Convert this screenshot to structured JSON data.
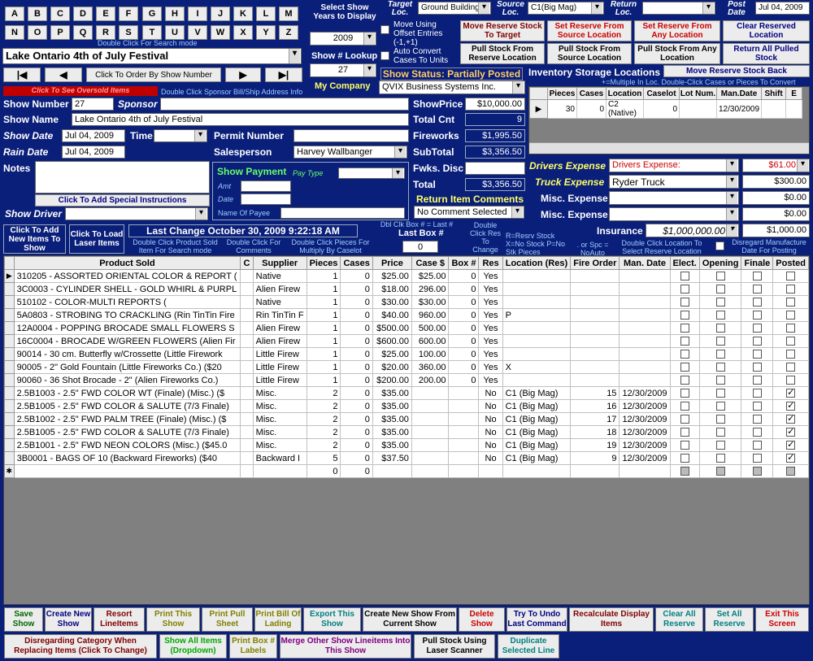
{
  "letters": [
    "A",
    "B",
    "C",
    "D",
    "E",
    "F",
    "G",
    "H",
    "I",
    "J",
    "K",
    "L",
    "M",
    "N",
    "O",
    "P",
    "Q",
    "R",
    "S",
    "T",
    "U",
    "V",
    "W",
    "X",
    "Y",
    "Z"
  ],
  "search_mode_hint": "Double Click For Search mode",
  "show_selector": {
    "value": "Lake Ontario 4th of July Festival"
  },
  "nav": {
    "first": "⏮",
    "prev": "◀",
    "next": "▶",
    "last": "⏭",
    "order_button": "Click To Order By Show Number"
  },
  "years": {
    "label": "Select Show Years to Display",
    "value": "2009"
  },
  "lookup": {
    "label": "Show # Lookup",
    "value": "27"
  },
  "my_company": {
    "label": "My Company",
    "value": "QVIX Business Systems Inc."
  },
  "target_loc": {
    "label": "Target Loc.",
    "value": "Ground Building"
  },
  "source_loc": {
    "label": "Source Loc.",
    "value": "C1(Big Mag)"
  },
  "return_loc": {
    "label": "Return Loc.",
    "value": ""
  },
  "post_date": {
    "label": "Post Date",
    "value": "Jul 04, 2009"
  },
  "offset_check": {
    "label": "Move Using Offset Entries (-1,+1)"
  },
  "auto_convert": {
    "label": "Auto Convert Cases To Units"
  },
  "action_buttons": {
    "move_reserve": "Move Reserve Stock To Target",
    "set_reserve_source": "Set Reserve From Source Location",
    "set_reserve_any": "Set Reserve From Any Location",
    "clear_reserved": "Clear Reserved Location",
    "pull_reserve": "Pull Stock From Reserve Location",
    "pull_source": "Pull Stock From Source Location",
    "pull_any": "Pull Stock From Any Location",
    "return_pulled": "Return All Pulled Stock"
  },
  "show_status": "Show Status: Partially Posted",
  "oversold": "Click To See Oversold Items",
  "sponsor_hint": "Double Click Sponsor Bill/Ship Address Info",
  "inventory": {
    "title": "Inventory Storage Locations",
    "move_back": "Move Reserve Stock Back",
    "hint": "+=Multiple In Loc.  Double-Click Cases or Pieces To Convert",
    "headers": [
      "Pieces",
      "Cases",
      "Location",
      "Caselot",
      "Lot Num.",
      "Man.Date",
      "Shift",
      "E"
    ],
    "row": [
      "30",
      "0",
      "C2 (Native)",
      "0",
      "",
      "12/30/2009",
      "",
      ""
    ]
  },
  "form": {
    "show_number_label": "Show Number",
    "show_number": "27",
    "sponsor_label": "Sponsor",
    "sponsor": "",
    "show_name_label": "Show Name",
    "show_name": "Lake Ontario 4th of July Festival",
    "show_date_label": "Show Date",
    "show_date": "Jul 04, 2009",
    "time_label": "Time",
    "time": "",
    "permit_label": "Permit Number",
    "permit": "",
    "rain_date_label": "Rain Date",
    "rain_date": "Jul 04, 2009",
    "salesperson_label": "Salesperson",
    "salesperson": "Harvey Wallbanger",
    "notes_label": "Notes",
    "notes": "",
    "special_btn": "Click To Add Special Instructions",
    "show_driver_label": "Show Driver",
    "show_driver": ""
  },
  "payment": {
    "title": "Show Payment",
    "pay_type": "Pay Type",
    "amt": "Amt",
    "date": "Date",
    "payee": "Name Of Payee"
  },
  "totals": {
    "show_price_label": "ShowPrice",
    "show_price": "$10,000.00",
    "total_cnt_label": "Total Cnt",
    "total_cnt": "9",
    "fireworks_label": "Fireworks",
    "fireworks": "$1,995.50",
    "subtotal_label": "SubTotal",
    "subtotal": "$3,356.50",
    "disc_label": "Fwks. Disc",
    "disc": "",
    "total_label": "Total",
    "total": "$3,356.50",
    "return_label": "Return Item Comments",
    "return_value": "No Comment Selected"
  },
  "expenses": {
    "drivers_label": "Drivers Expense",
    "drivers_value": "Drivers Expense:",
    "drivers_amt": "$61.00",
    "truck_label": "Truck Expense",
    "truck_value": "Ryder Truck",
    "truck_amt": "$300.00",
    "misc1_label": "Misc. Expense",
    "misc1_amt": "$0.00",
    "misc2_label": "Misc. Expense",
    "misc2_amt": "$0.00",
    "insurance_label": "Insurance",
    "insurance_value": "$1,000,000.00",
    "insurance_amt": "$1,000.00"
  },
  "row_bar": {
    "add_items": "Click To Add New Items To Show",
    "load_laser": "Click To Load Laser Items",
    "last_change": "Last Change October 30, 2009 9:22:18 AM",
    "h1": "Double Click Product Sold Item For Search mode",
    "h2": "Double Click For Comments",
    "h3": "Double Click Pieces For Multiply By Caselot",
    "box_hint": "Dbl Clk Box # = Last #",
    "last_box_label": "Last Box #",
    "last_box": "0",
    "res_hint": "Double Click Res To Change",
    "legend": "R=Resrv Stock X=No Stock P=No Stk Pieces",
    "legend2": ". or Spc = NoAuto",
    "loc_hint": "Double Click Location To Select Reserve Location",
    "disregard": "Disregard Manufacture Date For Posting"
  },
  "grid": {
    "headers": [
      "Product Sold",
      "C",
      "Supplier",
      "Pieces",
      "Cases",
      "Price",
      "Case $",
      "Box #",
      "Res",
      "Location (Res)",
      "Fire Order",
      "Man. Date",
      "Elect.",
      "Opening",
      "Finale",
      "Posted"
    ],
    "rows": [
      {
        "p": "310205 - ASSORTED ORIENTAL COLOR & REPORT (",
        "s": "Native",
        "pc": "1",
        "cs": "0",
        "pr": "$25.00",
        "cd": "$25.00",
        "bx": "0",
        "r": "Yes",
        "l": "",
        "f": "",
        "m": "",
        "e": false,
        "o": false,
        "fi": false,
        "po": false
      },
      {
        "p": "3C0003 - CYLINDER SHELL - GOLD WHIRL & PURPL",
        "s": "Alien Firew",
        "pc": "1",
        "cs": "0",
        "pr": "$18.00",
        "cd": "296.00",
        "bx": "0",
        "r": "Yes",
        "l": "",
        "f": "",
        "m": "",
        "e": false,
        "o": false,
        "fi": false,
        "po": false
      },
      {
        "p": "510102 - COLOR-MULTI REPORTS (",
        "s": "Native",
        "pc": "1",
        "cs": "0",
        "pr": "$30.00",
        "cd": "$30.00",
        "bx": "0",
        "r": "Yes",
        "l": "",
        "f": "",
        "m": "",
        "e": false,
        "o": false,
        "fi": false,
        "po": false
      },
      {
        "p": "5A0803 - STROBING TO CRACKLING (Rin TinTin Fire",
        "s": "Rin TinTin F",
        "pc": "1",
        "cs": "0",
        "pr": "$40.00",
        "cd": "960.00",
        "bx": "0",
        "r": "Yes",
        "l": "P",
        "f": "",
        "m": "",
        "e": false,
        "o": false,
        "fi": false,
        "po": false
      },
      {
        "p": "12A0004 - POPPING BROCADE SMALL FLOWERS S",
        "s": "Alien Firew",
        "pc": "1",
        "cs": "0",
        "pr": "$500.00",
        "cd": "500.00",
        "bx": "0",
        "r": "Yes",
        "l": "",
        "f": "",
        "m": "",
        "e": false,
        "o": false,
        "fi": false,
        "po": false
      },
      {
        "p": "16C0004 - BROCADE W/GREEN FLOWERS (Alien Fir",
        "s": "Alien Firew",
        "pc": "1",
        "cs": "0",
        "pr": "$600.00",
        "cd": "600.00",
        "bx": "0",
        "r": "Yes",
        "l": "",
        "f": "",
        "m": "",
        "e": false,
        "o": false,
        "fi": false,
        "po": false
      },
      {
        "p": "90014 - 30 cm. Butterfly w/Crossette (Little Firework",
        "s": "Little Firew",
        "pc": "1",
        "cs": "0",
        "pr": "$25.00",
        "cd": "100.00",
        "bx": "0",
        "r": "Yes",
        "l": "",
        "f": "",
        "m": "",
        "e": false,
        "o": false,
        "fi": false,
        "po": false
      },
      {
        "p": "90005 - 2\" Gold Fountain (Little Fireworks Co.) ($20",
        "s": "Little Firew",
        "pc": "1",
        "cs": "0",
        "pr": "$20.00",
        "cd": "360.00",
        "bx": "0",
        "r": "Yes",
        "l": "X",
        "f": "",
        "m": "",
        "e": false,
        "o": false,
        "fi": false,
        "po": false
      },
      {
        "p": "90060 - 36 Shot Brocade - 2\" (Alien Fireworks Co.)",
        "s": "Little Firew",
        "pc": "1",
        "cs": "0",
        "pr": "$200.00",
        "cd": "200.00",
        "bx": "0",
        "r": "Yes",
        "l": "",
        "f": "",
        "m": "",
        "e": false,
        "o": false,
        "fi": false,
        "po": false
      },
      {
        "p": "2.5B1003 - 2.5\" FWD COLOR WT (Finale) (Misc.) ($",
        "s": "Misc.",
        "pc": "2",
        "cs": "0",
        "pr": "$35.00",
        "cd": "",
        "bx": "",
        "r": "No",
        "l": "C1 (Big Mag)",
        "f": "15",
        "m": "12/30/2009",
        "e": false,
        "o": false,
        "fi": false,
        "po": true
      },
      {
        "p": "2.5B1005 - 2.5\" FWD COLOR & SALUTE (7/3 Finale)",
        "s": "Misc.",
        "pc": "2",
        "cs": "0",
        "pr": "$35.00",
        "cd": "",
        "bx": "",
        "r": "No",
        "l": "C1 (Big Mag)",
        "f": "16",
        "m": "12/30/2009",
        "e": false,
        "o": false,
        "fi": false,
        "po": true
      },
      {
        "p": "2.5B1002 - 2.5\" FWD PALM TREE (Finale) (Misc.) ($",
        "s": "Misc.",
        "pc": "2",
        "cs": "0",
        "pr": "$35.00",
        "cd": "",
        "bx": "",
        "r": "No",
        "l": "C1 (Big Mag)",
        "f": "17",
        "m": "12/30/2009",
        "e": false,
        "o": false,
        "fi": false,
        "po": true
      },
      {
        "p": "2.5B1005 - 2.5\" FWD COLOR & SALUTE (7/3 Finale)",
        "s": "Misc.",
        "pc": "2",
        "cs": "0",
        "pr": "$35.00",
        "cd": "",
        "bx": "",
        "r": "No",
        "l": "C1 (Big Mag)",
        "f": "18",
        "m": "12/30/2009",
        "e": false,
        "o": false,
        "fi": false,
        "po": true
      },
      {
        "p": "2.5B1001 - 2.5\" FWD NEON COLORS (Misc.) ($45.0",
        "s": "Misc.",
        "pc": "2",
        "cs": "0",
        "pr": "$35.00",
        "cd": "",
        "bx": "",
        "r": "No",
        "l": "C1 (Big Mag)",
        "f": "19",
        "m": "12/30/2009",
        "e": false,
        "o": false,
        "fi": false,
        "po": true
      },
      {
        "p": "3B0001 - BAGS OF 10 (Backward Fireworks) ($40",
        "s": "Backward I",
        "pc": "5",
        "cs": "0",
        "pr": "$37.50",
        "cd": "",
        "bx": "",
        "r": "No",
        "l": "C1 (Big Mag)",
        "f": "9",
        "m": "12/30/2009",
        "e": false,
        "o": false,
        "fi": false,
        "po": true
      }
    ],
    "new_row": {
      "pc": "0",
      "cs": "0"
    }
  },
  "bottom1": [
    {
      "t": "Save Show",
      "c": "#006600"
    },
    {
      "t": "Create New Show",
      "c": "#000080"
    },
    {
      "t": "Resort LineItems",
      "c": "#800000"
    },
    {
      "t": "Print This Show",
      "c": "#808000"
    },
    {
      "t": "Print Pull Sheet",
      "c": "#808000"
    },
    {
      "t": "Print Bill Of Lading",
      "c": "#808000"
    },
    {
      "t": "Export This Show",
      "c": "#008080"
    },
    {
      "t": "Create New Show From Current Show",
      "c": "#000000"
    },
    {
      "t": "Delete Show",
      "c": "#cc0000"
    },
    {
      "t": "Try To Undo Last Command",
      "c": "#000080"
    },
    {
      "t": "Recalculate Display Items",
      "c": "#800000"
    },
    {
      "t": "Clear All Reserve",
      "c": "#008080"
    },
    {
      "t": "Set All Reserve",
      "c": "#008080"
    },
    {
      "t": "Exit This Screen",
      "c": "#cc0000"
    }
  ],
  "bottom2": [
    {
      "t": "Disregarding Category When Replacing Items (Click To Change)",
      "c": "#800000"
    },
    {
      "t": "Show All Items (Dropdown)",
      "c": "#00aa00"
    },
    {
      "t": "Print Box # Labels",
      "c": "#808000"
    },
    {
      "t": "Merge Other Show Lineitems Into This Show",
      "c": "#800080"
    },
    {
      "t": "Pull Stock Using Laser Scanner",
      "c": "#000000"
    },
    {
      "t": "Duplicate Selected Line",
      "c": "#008080"
    }
  ]
}
